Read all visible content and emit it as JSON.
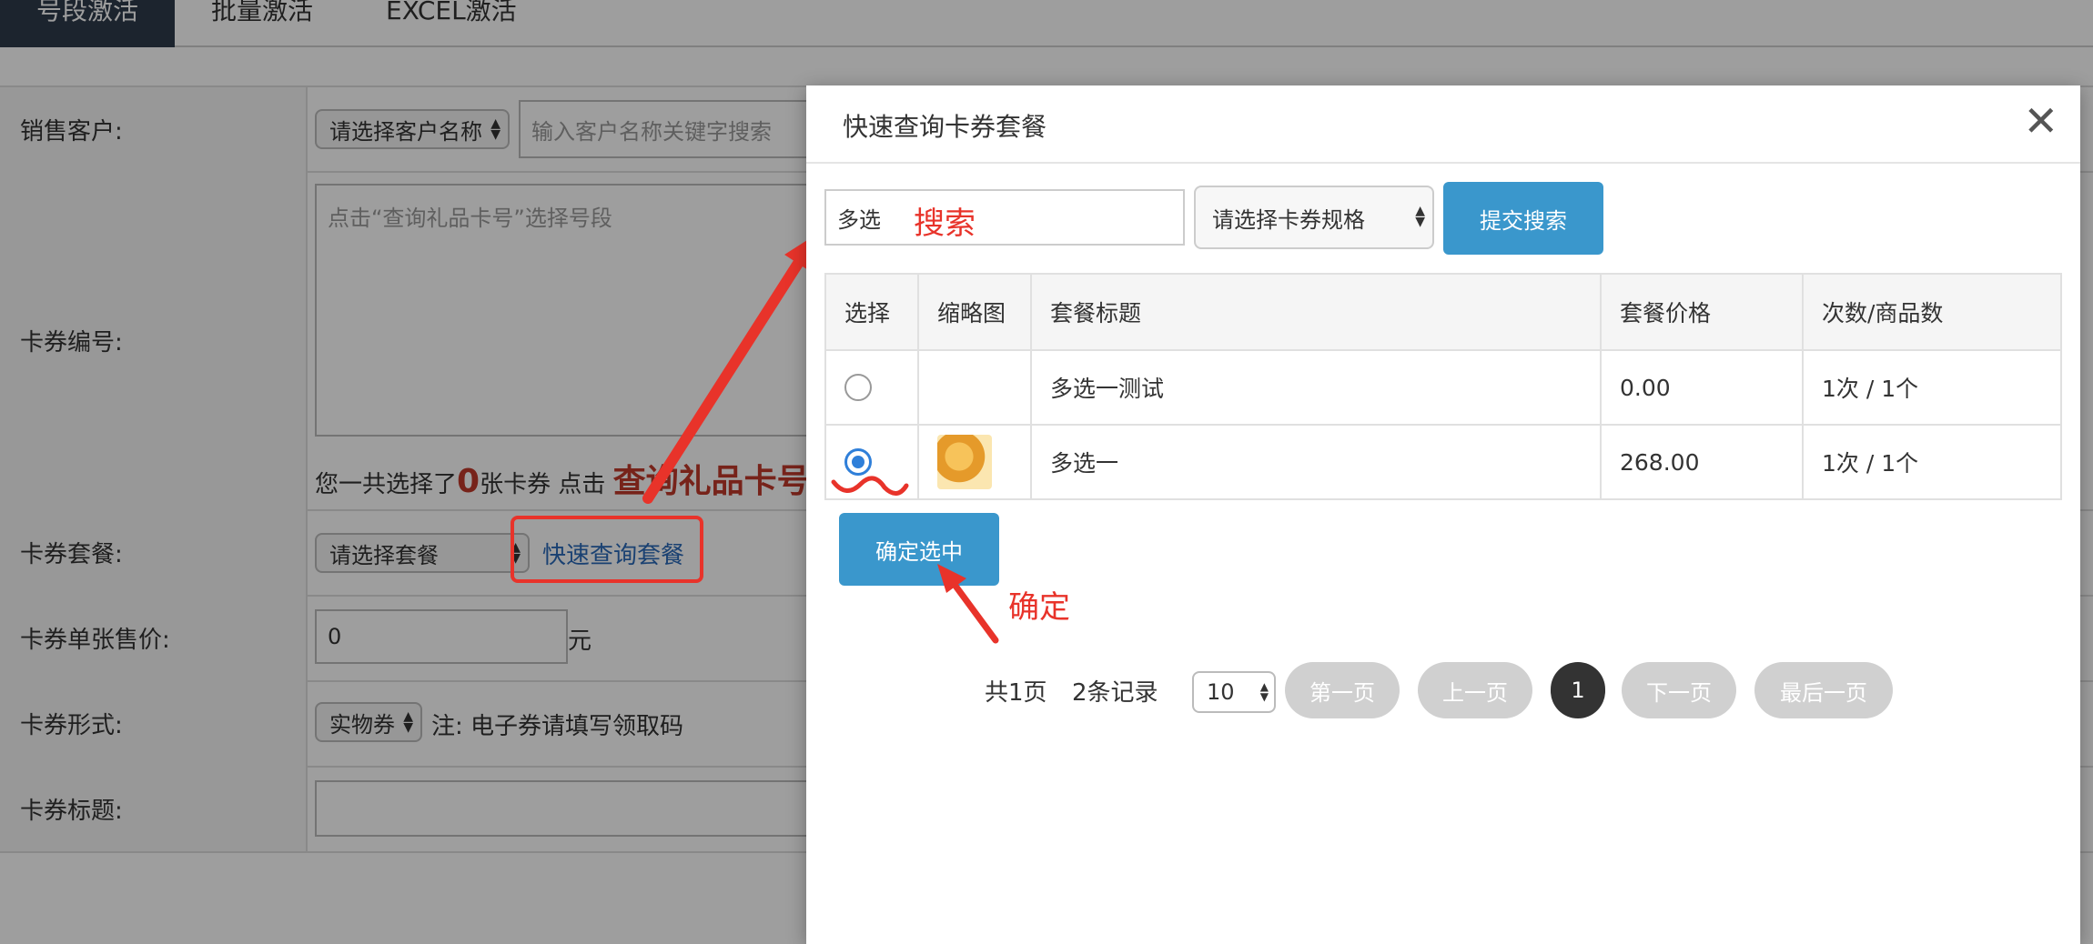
{
  "tabs": [
    "号段激活",
    "批量激活",
    "EXCEL激活"
  ],
  "form": {
    "customer_label": "销售客户:",
    "customer_select": "请选择客户名称",
    "customer_search_placeholder": "输入客户名称关键字搜索",
    "card_no_label": "卡券编号:",
    "card_no_placeholder": "点击“查询礼品卡号”选择号段",
    "selected_prefix": "您一共选择了",
    "selected_count": "0",
    "selected_suffix": "张卡券 点击",
    "query_card_link": "查询礼品卡号",
    "package_label": "卡券套餐:",
    "package_select": "请选择套餐",
    "quick_query_link": "快速查询套餐",
    "price_label": "卡券单张售价:",
    "price_value": "0",
    "price_unit": "元",
    "form_label": "卡券形式:",
    "form_select": "实物券",
    "form_note": "注: 电子券请填写领取码",
    "title_label": "卡券标题:"
  },
  "modal": {
    "title": "快速查询卡券套餐",
    "close_icon": "close-icon",
    "search_value": "多选",
    "spec_select": "请选择卡券规格",
    "submit_search": "提交搜索",
    "columns": [
      "选择",
      "缩略图",
      "套餐标题",
      "套餐价格",
      "次数/商品数"
    ],
    "rows": [
      {
        "selected": false,
        "has_thumb": false,
        "title": "多选一测试",
        "price": "0.00",
        "count": "1次 / 1个"
      },
      {
        "selected": true,
        "has_thumb": true,
        "title": "多选一",
        "price": "268.00",
        "count": "1次 / 1个"
      }
    ],
    "confirm_button": "确定选中",
    "pagination": {
      "total_pages": "共1页",
      "total_records": "2条记录",
      "page_size": "10",
      "first": "第一页",
      "prev": "上一页",
      "current": "1",
      "next": "下一页",
      "last": "最后一页"
    }
  },
  "annotations": {
    "search": "搜索",
    "confirm": "确定"
  },
  "colors": {
    "accent_blue": "#3a97cc",
    "annotation_red": "#e8332a",
    "dark_tab": "#2e3a4b"
  }
}
